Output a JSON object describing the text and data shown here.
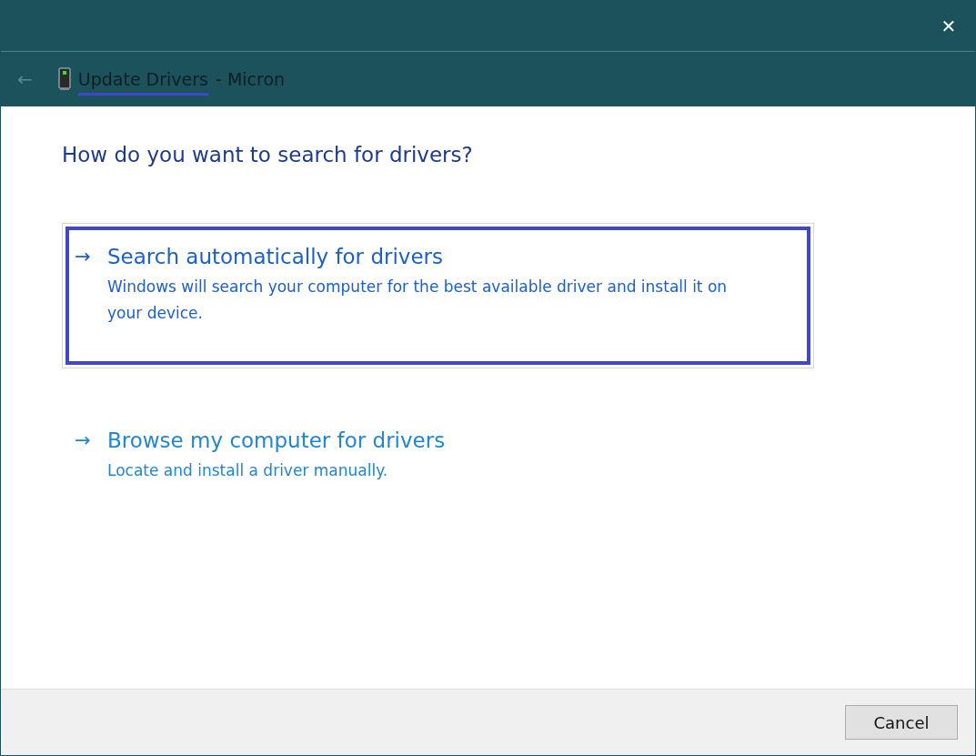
{
  "window": {
    "close": "✕"
  },
  "header": {
    "back": "←",
    "title_segments": [
      {
        "text": "Update Drivers",
        "underlined": true
      },
      {
        "text": "- Micron",
        "underlined": false
      }
    ]
  },
  "heading": "How do you want to search for drivers?",
  "options": [
    {
      "arrow": "→",
      "title": "Search automatically for drivers",
      "description": "Windows will search your computer for the best available driver and install it on your device.",
      "selected": true
    },
    {
      "arrow": "→",
      "title": "Browse my computer for drivers",
      "description": "Locate and install a driver manually.",
      "selected": false
    }
  ],
  "buttons": [
    "Cancel"
  ]
}
